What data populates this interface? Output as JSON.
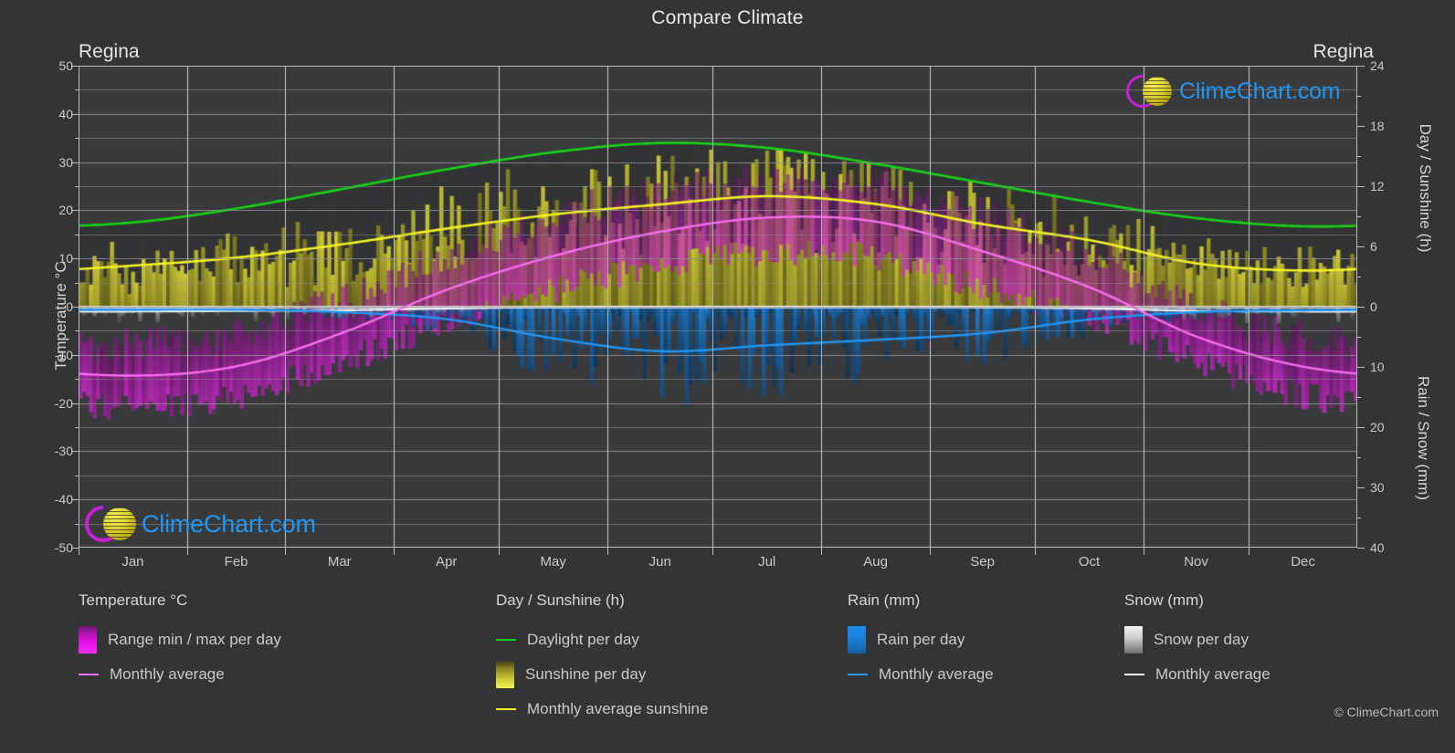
{
  "header": {
    "title": "Compare Climate",
    "station_left": "Regina",
    "station_right": "Regina"
  },
  "axes": {
    "left": {
      "label": "Temperature °C",
      "ticks": [
        "50",
        "40",
        "30",
        "20",
        "10",
        "0",
        "-10",
        "-20",
        "-30",
        "-40",
        "-50"
      ],
      "min": -50,
      "max": 50
    },
    "right_top": {
      "label": "Day / Sunshine (h)",
      "ticks": [
        "24",
        "18",
        "12",
        "6",
        "0"
      ],
      "min": 0,
      "max": 24
    },
    "right_bottom": {
      "label": "Rain / Snow (mm)",
      "ticks": [
        "0",
        "10",
        "20",
        "30",
        "40"
      ],
      "min": 0,
      "max": 40
    },
    "x": {
      "ticks": [
        "Jan",
        "Feb",
        "Mar",
        "Apr",
        "May",
        "Jun",
        "Jul",
        "Aug",
        "Sep",
        "Oct",
        "Nov",
        "Dec"
      ]
    }
  },
  "legend": {
    "temperature": {
      "heading": "Temperature °C",
      "items": [
        {
          "label": "Range min / max per day",
          "marker": "swatch",
          "color": "#e312e0"
        },
        {
          "label": "Monthly average",
          "marker": "line",
          "color": "#f96df0"
        }
      ]
    },
    "daysun": {
      "heading": "Day / Sunshine (h)",
      "items": [
        {
          "label": "Daylight per day",
          "marker": "line",
          "color": "#17d317"
        },
        {
          "label": "Sunshine per day",
          "marker": "swatch",
          "color": "#eeee3c"
        },
        {
          "label": "Monthly average sunshine",
          "marker": "line",
          "color": "#f2f224"
        }
      ]
    },
    "rain": {
      "heading": "Rain (mm)",
      "items": [
        {
          "label": "Rain per day",
          "marker": "swatch",
          "color": "#1782e0"
        },
        {
          "label": "Monthly average",
          "marker": "line",
          "color": "#2196f3"
        }
      ]
    },
    "snow": {
      "heading": "Snow (mm)",
      "items": [
        {
          "label": "Snow per day",
          "marker": "swatch",
          "color": "#e8e8e8"
        },
        {
          "label": "Monthly average",
          "marker": "line",
          "color": "#f2f2f2"
        }
      ]
    }
  },
  "watermark": {
    "text": "ClimeChart.com"
  },
  "copyright": "© ClimeChart.com",
  "colors": {
    "background": "#333436",
    "plot_background": "#393a3c",
    "grid": "#8d8e90",
    "axis": "#b9babb",
    "text": "#c9cacb",
    "daylight": "#17d317",
    "sunshine_bar": "#b5b033",
    "sunshine_avg": "#f2f224",
    "temp_bar": "#c020c0",
    "temp_avg": "#f96df0",
    "rain_bar": "#1c6fae",
    "rain_avg": "#2196f3",
    "snow_bar": "#9a9a9a",
    "snow_avg": "#f2f2f2",
    "logo_magenta": "#c820d8",
    "logo_yellow": "#e3d93f",
    "logo_blue": "#2196f3"
  },
  "chart_data": {
    "type": "line",
    "title": "Compare Climate",
    "subtitle": "Regina",
    "xlabel": "",
    "ylabel": "Temperature °C",
    "ylim": [
      -50,
      50
    ],
    "grid": true,
    "legend_position": "below",
    "categories": [
      "Jan",
      "Feb",
      "Mar",
      "Apr",
      "May",
      "Jun",
      "Jul",
      "Aug",
      "Sep",
      "Oct",
      "Nov",
      "Dec"
    ],
    "series": [
      {
        "name": "Daylight per day",
        "unit": "h",
        "axis": "right_top",
        "color": "#17d317",
        "values": [
          8.4,
          9.8,
          11.7,
          13.7,
          15.4,
          16.3,
          15.8,
          14.2,
          12.3,
          10.4,
          8.8,
          8.0
        ]
      },
      {
        "name": "Monthly average sunshine",
        "unit": "h",
        "axis": "right_top",
        "color": "#f2f224",
        "values": [
          4.1,
          4.9,
          6.2,
          7.8,
          9.2,
          10.2,
          11.0,
          10.2,
          8.2,
          6.6,
          4.3,
          3.6
        ]
      },
      {
        "name": "Monthly average temperature",
        "unit": "°C",
        "axis": "left",
        "color": "#f96df0",
        "values": [
          -14.3,
          -12.3,
          -5.5,
          3.6,
          10.6,
          15.6,
          18.5,
          17.6,
          11.4,
          3.9,
          -6.3,
          -12.5
        ]
      },
      {
        "name": "Monthly average rain",
        "unit": "mm",
        "axis": "right_bottom",
        "color": "#2196f3",
        "values": [
          0.5,
          0.5,
          0.9,
          2.1,
          5.3,
          7.4,
          6.4,
          5.5,
          4.4,
          2.1,
          0.9,
          0.6
        ]
      },
      {
        "name": "Monthly average snow",
        "unit": "mm",
        "axis": "right_bottom",
        "color": "#f2f2f2",
        "values": [
          0.8,
          0.7,
          0.6,
          0.3,
          0.05,
          0.0,
          0.0,
          0.0,
          0.05,
          0.3,
          0.7,
          0.8
        ]
      },
      {
        "name": "Temperature range max per day",
        "unit": "°C",
        "axis": "left",
        "color": "#c020c0",
        "values": [
          -8.0,
          -5.5,
          1.5,
          11.0,
          19.0,
          23.5,
          26.5,
          25.5,
          19.0,
          11.0,
          -0.5,
          -6.5
        ]
      },
      {
        "name": "Temperature range min per day",
        "unit": "°C",
        "axis": "left",
        "color": "#c020c0",
        "values": [
          -21.0,
          -18.5,
          -11.5,
          -3.0,
          3.5,
          8.5,
          11.0,
          10.0,
          4.0,
          -2.5,
          -11.5,
          -18.5
        ]
      }
    ]
  }
}
